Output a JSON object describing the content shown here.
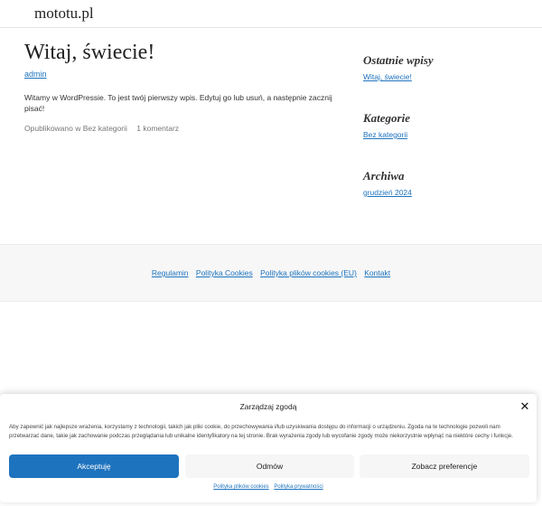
{
  "header": {
    "site_title": "mototu.pl"
  },
  "post": {
    "title": "Witaj, świecie!",
    "author": "admin",
    "body": "Witamy w WordPressie. To jest twój pierwszy wpis. Edytuj go lub usuń, a następnie zacznij pisać!",
    "meta_published": "Opublikowano w Bez kategorii",
    "meta_comments": "1 komentarz"
  },
  "sidebar": {
    "recent": {
      "title": "Ostatnie wpisy",
      "link": "Witaj, świecie!"
    },
    "categories": {
      "title": "Kategorie",
      "link": "Bez kategorii"
    },
    "archives": {
      "title": "Archiwa",
      "link": "grudzień 2024"
    }
  },
  "footer": {
    "links": [
      "Regulamin",
      "Polityka Cookies",
      "Polityka plików cookies (EU)",
      "Kontakt"
    ]
  },
  "consent": {
    "title": "Zarządzaj zgodą",
    "close_icon": "close-icon",
    "text": "Aby zapewnić jak najlepsze wrażenia, korzystamy z technologii, takich jak pliki cookie, do przechowywania i/lub uzyskiwania dostępu do informacji o urządzeniu. Zgoda na te technologie pozwoli nam przetwarzać dane, takie jak zachowanie podczas przeglądania lub unikalne identyfikatory na tej stronie. Brak wyrażenia zgody lub wycofanie zgody może niekorzystnie wpłynąć na niektóre cechy i funkcje.",
    "accept_label": "Akceptuję",
    "deny_label": "Odmów",
    "prefs_label": "Zobacz preferencje",
    "link_cookies": "Polityka plików cookies",
    "link_privacy": "Polityka prywatności"
  },
  "colors": {
    "accent": "#1e73be",
    "footer_bg": "#f7f7f7"
  }
}
